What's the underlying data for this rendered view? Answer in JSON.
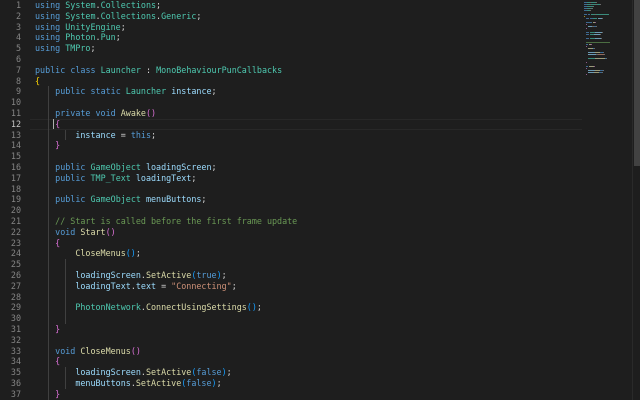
{
  "editor": {
    "language": "csharp",
    "active_line": 12,
    "colors": {
      "background": "#1e1e1e",
      "keyword": "#569cd6",
      "type": "#4ec9b0",
      "function": "#dcdcaa",
      "variable": "#9cdcfe",
      "string": "#ce9178",
      "comment": "#6a9955",
      "line_number": "#858585"
    },
    "lines": [
      {
        "n": "1",
        "tokens": [
          [
            "kw",
            "using"
          ],
          [
            "p",
            " "
          ],
          [
            "type",
            "System"
          ],
          [
            "p",
            "."
          ],
          [
            "type",
            "Collections"
          ],
          [
            "p",
            ";"
          ]
        ]
      },
      {
        "n": "2",
        "tokens": [
          [
            "kw",
            "using"
          ],
          [
            "p",
            " "
          ],
          [
            "type",
            "System"
          ],
          [
            "p",
            "."
          ],
          [
            "type",
            "Collections"
          ],
          [
            "p",
            "."
          ],
          [
            "type",
            "Generic"
          ],
          [
            "p",
            ";"
          ]
        ]
      },
      {
        "n": "3",
        "tokens": [
          [
            "kw",
            "using"
          ],
          [
            "p",
            " "
          ],
          [
            "type",
            "UnityEngine"
          ],
          [
            "p",
            ";"
          ]
        ]
      },
      {
        "n": "4",
        "tokens": [
          [
            "kw",
            "using"
          ],
          [
            "p",
            " "
          ],
          [
            "type",
            "Photon"
          ],
          [
            "p",
            "."
          ],
          [
            "type",
            "Pun"
          ],
          [
            "p",
            ";"
          ]
        ]
      },
      {
        "n": "5",
        "tokens": [
          [
            "kw",
            "using"
          ],
          [
            "p",
            " "
          ],
          [
            "type",
            "TMPro"
          ],
          [
            "p",
            ";"
          ]
        ]
      },
      {
        "n": "6",
        "tokens": []
      },
      {
        "n": "7",
        "tokens": [
          [
            "kw",
            "public"
          ],
          [
            "p",
            " "
          ],
          [
            "kw",
            "class"
          ],
          [
            "p",
            " "
          ],
          [
            "type",
            "Launcher"
          ],
          [
            "p",
            " : "
          ],
          [
            "type",
            "MonoBehaviourPunCallbacks"
          ]
        ]
      },
      {
        "n": "8",
        "tokens": [
          [
            "br1",
            "{"
          ]
        ]
      },
      {
        "n": "9",
        "tokens": [
          [
            "p",
            "    "
          ],
          [
            "kw",
            "public"
          ],
          [
            "p",
            " "
          ],
          [
            "kw",
            "static"
          ],
          [
            "p",
            " "
          ],
          [
            "type",
            "Launcher"
          ],
          [
            "p",
            " "
          ],
          [
            "var",
            "instance"
          ],
          [
            "p",
            ";"
          ]
        ]
      },
      {
        "n": "10",
        "tokens": []
      },
      {
        "n": "11",
        "tokens": [
          [
            "p",
            "    "
          ],
          [
            "kw",
            "private"
          ],
          [
            "p",
            " "
          ],
          [
            "kw",
            "void"
          ],
          [
            "p",
            " "
          ],
          [
            "fn",
            "Awake"
          ],
          [
            "br2",
            "()"
          ]
        ]
      },
      {
        "n": "12",
        "tokens": [
          [
            "p",
            "    "
          ],
          [
            "br2",
            "{"
          ]
        ]
      },
      {
        "n": "13",
        "tokens": [
          [
            "p",
            "        "
          ],
          [
            "var",
            "instance"
          ],
          [
            "p",
            " = "
          ],
          [
            "kw",
            "this"
          ],
          [
            "p",
            ";"
          ]
        ]
      },
      {
        "n": "14",
        "tokens": [
          [
            "p",
            "    "
          ],
          [
            "br2",
            "}"
          ]
        ]
      },
      {
        "n": "15",
        "tokens": []
      },
      {
        "n": "16",
        "tokens": [
          [
            "p",
            "    "
          ],
          [
            "kw",
            "public"
          ],
          [
            "p",
            " "
          ],
          [
            "type",
            "GameObject"
          ],
          [
            "p",
            " "
          ],
          [
            "var",
            "loadingScreen"
          ],
          [
            "p",
            ";"
          ]
        ]
      },
      {
        "n": "17",
        "tokens": [
          [
            "p",
            "    "
          ],
          [
            "kw",
            "public"
          ],
          [
            "p",
            " "
          ],
          [
            "type",
            "TMP_Text"
          ],
          [
            "p",
            " "
          ],
          [
            "var",
            "loadingText"
          ],
          [
            "p",
            ";"
          ]
        ]
      },
      {
        "n": "18",
        "tokens": []
      },
      {
        "n": "19",
        "tokens": [
          [
            "p",
            "    "
          ],
          [
            "kw",
            "public"
          ],
          [
            "p",
            " "
          ],
          [
            "type",
            "GameObject"
          ],
          [
            "p",
            " "
          ],
          [
            "var",
            "menuButtons"
          ],
          [
            "p",
            ";"
          ]
        ]
      },
      {
        "n": "20",
        "tokens": []
      },
      {
        "n": "21",
        "tokens": [
          [
            "p",
            "    "
          ],
          [
            "cmt",
            "// Start is called before the first frame update"
          ]
        ]
      },
      {
        "n": "22",
        "tokens": [
          [
            "p",
            "    "
          ],
          [
            "kw",
            "void"
          ],
          [
            "p",
            " "
          ],
          [
            "fn",
            "Start"
          ],
          [
            "br2",
            "()"
          ]
        ]
      },
      {
        "n": "23",
        "tokens": [
          [
            "p",
            "    "
          ],
          [
            "br2",
            "{"
          ]
        ]
      },
      {
        "n": "24",
        "tokens": [
          [
            "p",
            "        "
          ],
          [
            "fn",
            "CloseMenus"
          ],
          [
            "br3",
            "()"
          ],
          [
            "p",
            ";"
          ]
        ]
      },
      {
        "n": "25",
        "tokens": []
      },
      {
        "n": "26",
        "tokens": [
          [
            "p",
            "        "
          ],
          [
            "var",
            "loadingScreen"
          ],
          [
            "p",
            "."
          ],
          [
            "fn",
            "SetActive"
          ],
          [
            "br3",
            "("
          ],
          [
            "kw",
            "true"
          ],
          [
            "br3",
            ")"
          ],
          [
            "p",
            ";"
          ]
        ]
      },
      {
        "n": "27",
        "tokens": [
          [
            "p",
            "        "
          ],
          [
            "var",
            "loadingText"
          ],
          [
            "p",
            "."
          ],
          [
            "var",
            "text"
          ],
          [
            "p",
            " = "
          ],
          [
            "str",
            "\"Connecting\""
          ],
          [
            "p",
            ";"
          ]
        ]
      },
      {
        "n": "28",
        "tokens": []
      },
      {
        "n": "29",
        "tokens": [
          [
            "p",
            "        "
          ],
          [
            "type",
            "PhotonNetwork"
          ],
          [
            "p",
            "."
          ],
          [
            "fn",
            "ConnectUsingSettings"
          ],
          [
            "br3",
            "()"
          ],
          [
            "p",
            ";"
          ]
        ]
      },
      {
        "n": "30",
        "tokens": []
      },
      {
        "n": "31",
        "tokens": [
          [
            "p",
            "    "
          ],
          [
            "br2",
            "}"
          ]
        ]
      },
      {
        "n": "32",
        "tokens": []
      },
      {
        "n": "33",
        "tokens": [
          [
            "p",
            "    "
          ],
          [
            "kw",
            "void"
          ],
          [
            "p",
            " "
          ],
          [
            "fn",
            "CloseMenus"
          ],
          [
            "br2",
            "()"
          ]
        ]
      },
      {
        "n": "34",
        "tokens": [
          [
            "p",
            "    "
          ],
          [
            "br2",
            "{"
          ]
        ]
      },
      {
        "n": "35",
        "tokens": [
          [
            "p",
            "        "
          ],
          [
            "var",
            "loadingScreen"
          ],
          [
            "p",
            "."
          ],
          [
            "fn",
            "SetActive"
          ],
          [
            "br3",
            "("
          ],
          [
            "kw",
            "false"
          ],
          [
            "br3",
            ")"
          ],
          [
            "p",
            ";"
          ]
        ]
      },
      {
        "n": "36",
        "tokens": [
          [
            "p",
            "        "
          ],
          [
            "var",
            "menuButtons"
          ],
          [
            "p",
            "."
          ],
          [
            "fn",
            "SetActive"
          ],
          [
            "br3",
            "("
          ],
          [
            "kw",
            "false"
          ],
          [
            "br3",
            ")"
          ],
          [
            "p",
            ";"
          ]
        ]
      },
      {
        "n": "37",
        "tokens": [
          [
            "p",
            "    "
          ],
          [
            "br2",
            "}"
          ]
        ]
      }
    ]
  }
}
